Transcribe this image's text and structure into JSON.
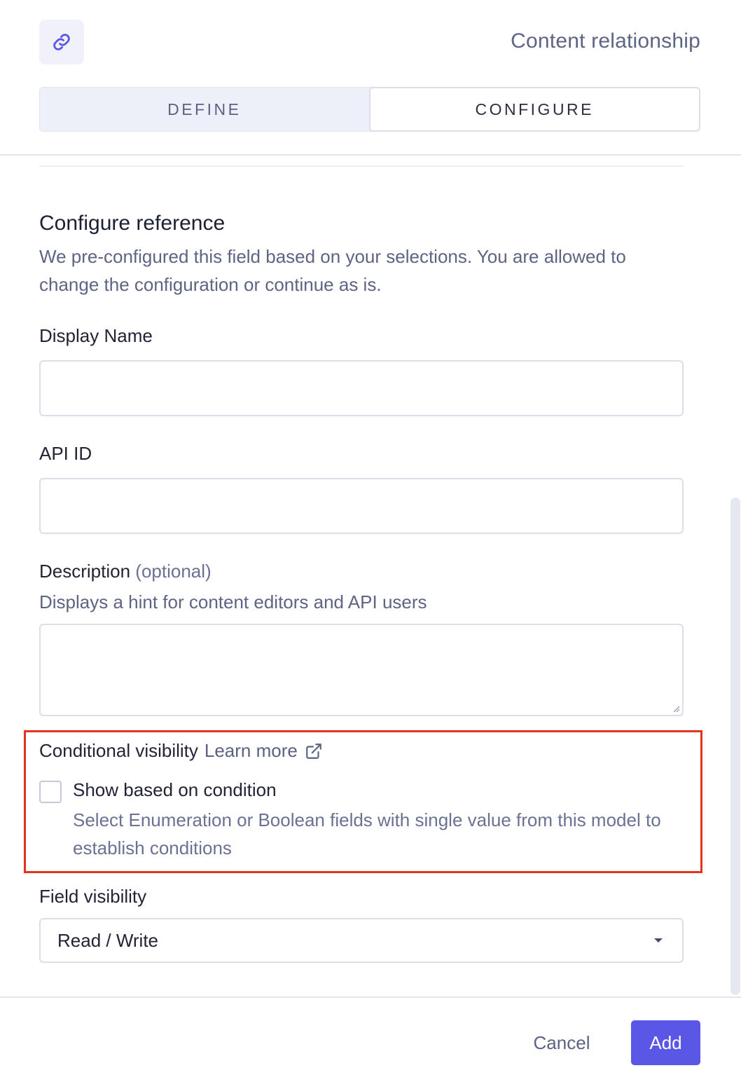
{
  "header": {
    "icon": "link-icon",
    "title": "Content relationship"
  },
  "tabs": [
    {
      "label": "DEFINE",
      "active": false
    },
    {
      "label": "CONFIGURE",
      "active": true
    }
  ],
  "section": {
    "title": "Configure reference",
    "description": "We pre-configured this field based on your selections. You are allowed to change the configuration or continue as is."
  },
  "fields": {
    "display_name": {
      "label": "Display Name",
      "value": "",
      "placeholder": ""
    },
    "api_id": {
      "label": "API ID",
      "value": "",
      "placeholder": ""
    },
    "description": {
      "label": "Description",
      "optional": "(optional)",
      "hint": "Displays a hint for content editors and API users",
      "value": ""
    }
  },
  "conditional_visibility": {
    "label": "Conditional visibility",
    "learn_more": "Learn more",
    "checkbox_label": "Show based on condition",
    "checkbox_checked": false,
    "checkbox_description": "Select Enumeration or Boolean fields with single value from this model to establish conditions",
    "highlight_color": "#e3341d"
  },
  "field_visibility": {
    "label": "Field visibility",
    "selected": "Read / Write"
  },
  "footer": {
    "cancel_label": "Cancel",
    "add_label": "Add"
  },
  "colors": {
    "accent": "#5b57e6",
    "muted_text": "#5e6483"
  }
}
